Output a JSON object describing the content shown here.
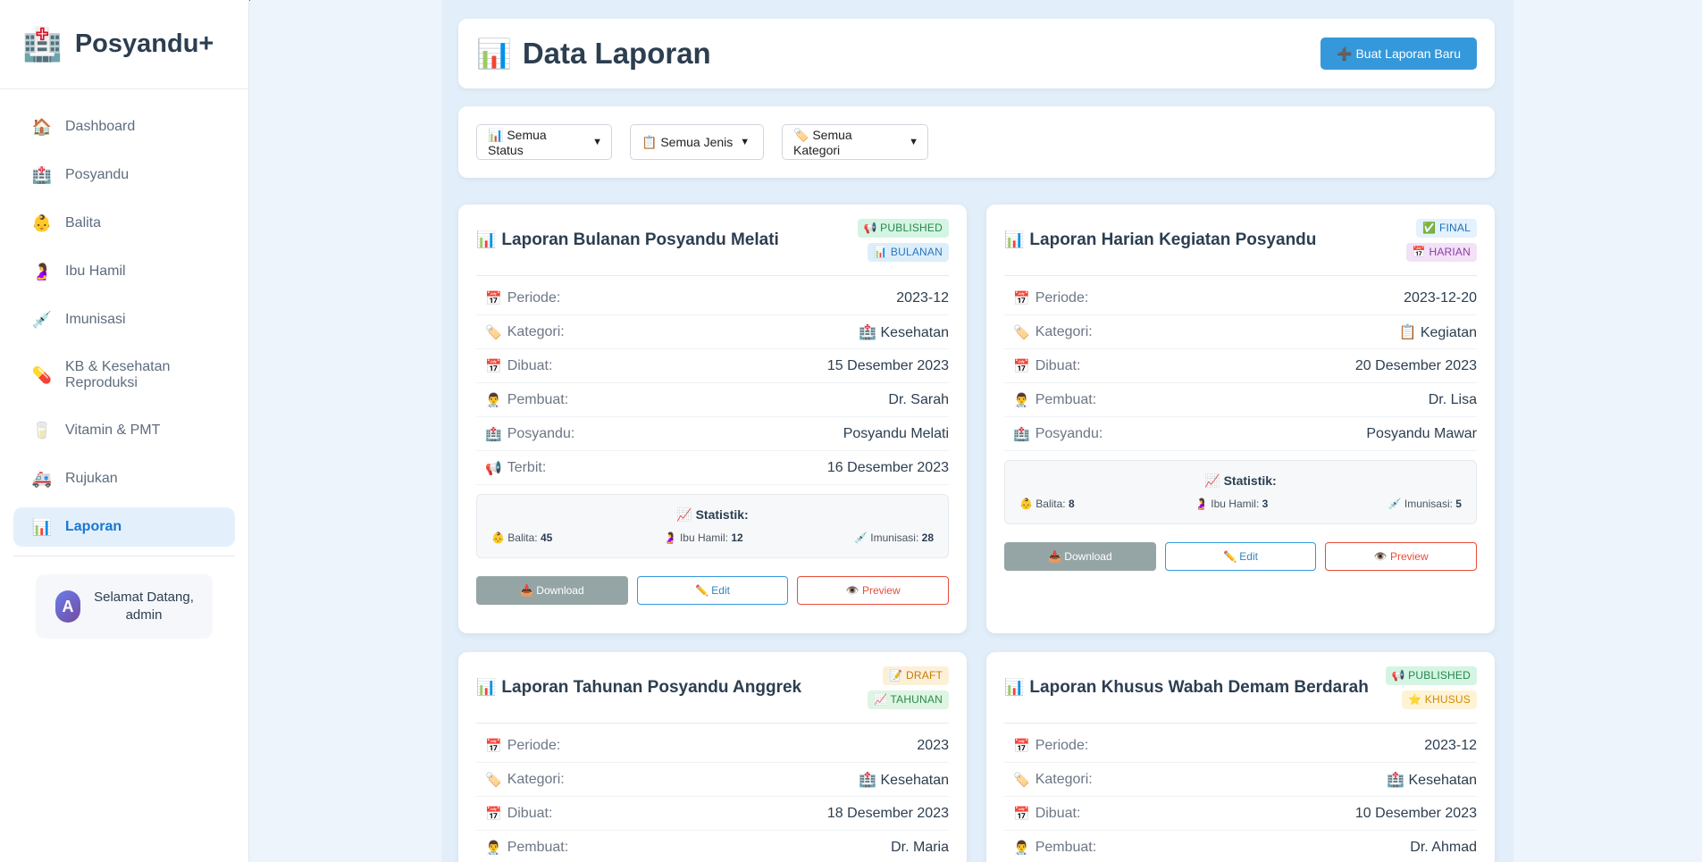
{
  "app": {
    "brand_icon": "hospital-icon",
    "brand_glyph": "🏥",
    "name": "Posyandu+"
  },
  "sidebar": {
    "items": [
      {
        "label": "Dashboard",
        "icon": "house-icon",
        "glyph": "🏠"
      },
      {
        "label": "Posyandu",
        "icon": "hospital-icon",
        "glyph": "🏥"
      },
      {
        "label": "Balita",
        "icon": "baby-icon",
        "glyph": "👶"
      },
      {
        "label": "Ibu Hamil",
        "icon": "pregnant-woman-icon",
        "glyph": "🤰"
      },
      {
        "label": "Imunisasi",
        "icon": "syringe-icon",
        "glyph": "💉"
      },
      {
        "label": "KB & Kesehatan Reproduksi",
        "icon": "pill-icon",
        "glyph": "💊"
      },
      {
        "label": "Vitamin & PMT",
        "icon": "milk-glass-icon",
        "glyph": "🥛"
      },
      {
        "label": "Rujukan",
        "icon": "ambulance-icon",
        "glyph": "🚑"
      },
      {
        "label": "Laporan",
        "icon": "bar-chart-icon",
        "glyph": "📊",
        "active": true
      }
    ],
    "user": {
      "avatar_letter": "A",
      "greeting": "Selamat Datang, admin"
    }
  },
  "header": {
    "title_glyph": "📊",
    "title": "Data Laporan",
    "new_button": "➕ Buat Laporan Baru"
  },
  "filters": {
    "status": "📊 Semua Status",
    "jenis": "📋 Semua Jenis",
    "kategori": "🏷️ Semua Kategori"
  },
  "labels": {
    "periode": "Periode:",
    "kategori": "Kategori:",
    "dibuat": "Dibuat:",
    "pembuat": "Pembuat:",
    "posyandu": "Posyandu:",
    "terbit": "Terbit:",
    "statistik": "📈 Statistik:",
    "balita": "👶 Balita:",
    "ibu_hamil": "🤰 Ibu Hamil:",
    "imunisasi": "💉 Imunisasi:",
    "download": "📥 Download",
    "edit": "✏️ Edit",
    "preview": "👁️ Preview"
  },
  "reports": [
    {
      "title": "Laporan Bulanan Posyandu Melati",
      "status_badge": "📢 PUBLISHED",
      "type_badge": "📊 BULANAN",
      "periode": "2023-12",
      "kategori": "🏥 Kesehatan",
      "dibuat": "15 Desember 2023",
      "pembuat": "Dr. Sarah",
      "posyandu": "Posyandu Melati",
      "terbit": "16 Desember 2023",
      "stats": {
        "balita": "45",
        "ibu_hamil": "12",
        "imunisasi": "28"
      }
    },
    {
      "title": "Laporan Harian Kegiatan Posyandu",
      "status_badge": "✅ FINAL",
      "type_badge": "📅 HARIAN",
      "periode": "2023-12-20",
      "kategori": "📋 Kegiatan",
      "dibuat": "20 Desember 2023",
      "pembuat": "Dr. Lisa",
      "posyandu": "Posyandu Mawar",
      "stats": {
        "balita": "8",
        "ibu_hamil": "3",
        "imunisasi": "5"
      }
    },
    {
      "title": "Laporan Tahunan Posyandu Anggrek",
      "status_badge": "📝 DRAFT",
      "type_badge": "📈 TAHUNAN",
      "periode": "2023",
      "kategori": "🏥 Kesehatan",
      "dibuat": "18 Desember 2023",
      "pembuat": "Dr. Maria"
    },
    {
      "title": "Laporan Khusus Wabah Demam Berdarah",
      "status_badge": "📢 PUBLISHED",
      "type_badge": "⭐ KHUSUS",
      "periode": "2023-12",
      "kategori": "🏥 Kesehatan",
      "dibuat": "10 Desember 2023",
      "pembuat": "Dr. Ahmad"
    }
  ]
}
